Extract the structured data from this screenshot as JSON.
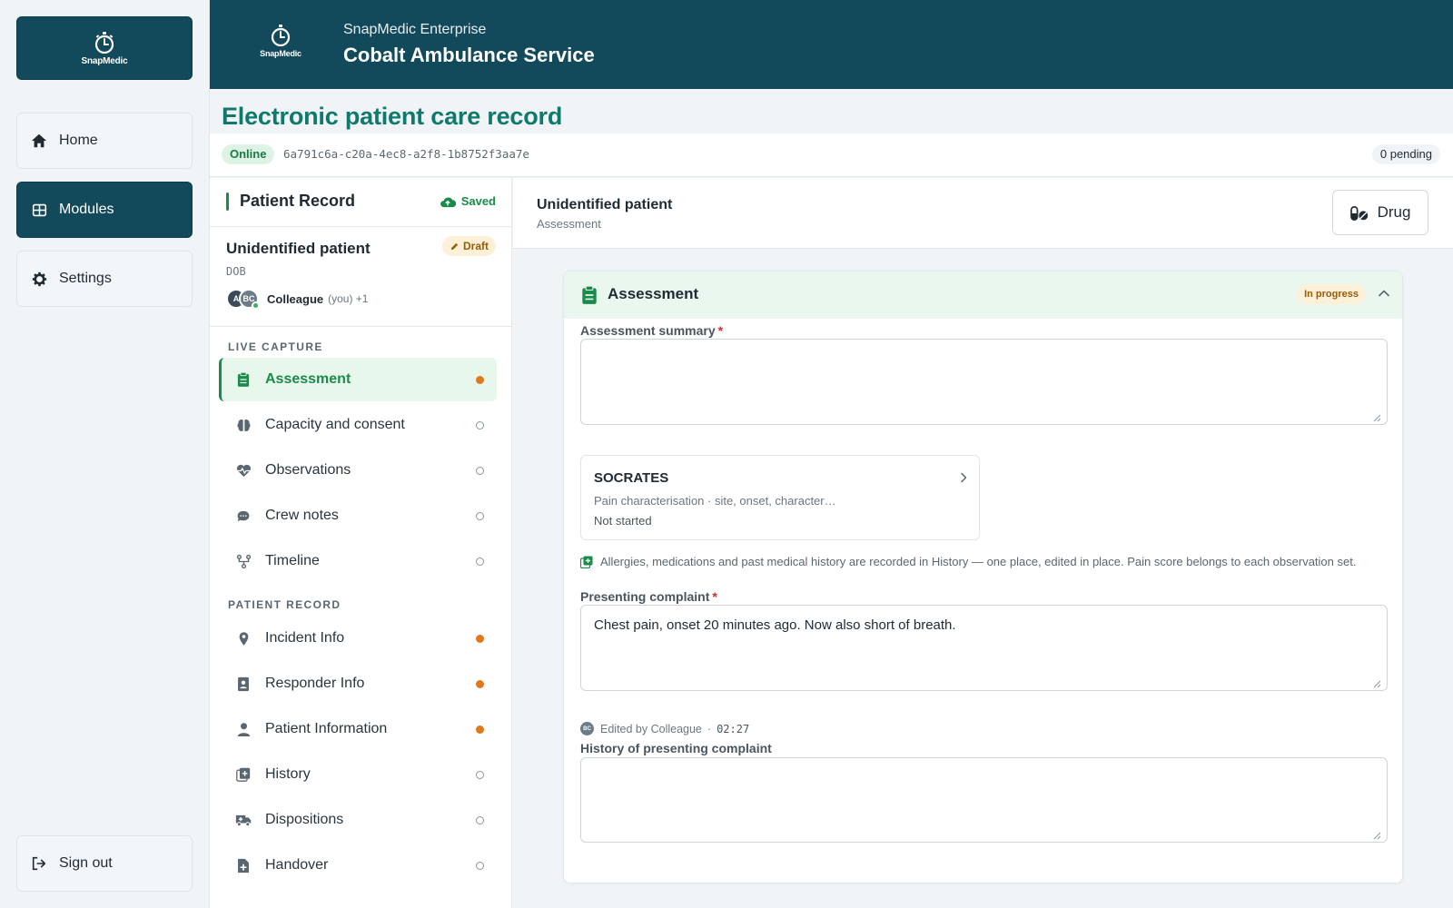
{
  "brand": {
    "logo_text": "SnapMedic"
  },
  "nav": {
    "home": "Home",
    "modules": "Modules",
    "settings": "Settings",
    "sign_out": "Sign out"
  },
  "header": {
    "org_sub": "SnapMedic Enterprise",
    "org_name": "Cobalt Ambulance Service"
  },
  "page": {
    "title": "Electronic patient care record",
    "online": "Online",
    "record_id": "6a791c6a-c20a-4ec8-a2f8-1b8752f3aa7e",
    "pending": "0 pending"
  },
  "patient_record": {
    "title": "Patient Record",
    "saved": "Saved",
    "patient_name": "Unidentified patient",
    "draft": "Draft",
    "dob": "DOB",
    "avatar_a": "A",
    "avatar_bc": "BC",
    "collaborator": "Colleague",
    "collaborator_meta": "(you) +1"
  },
  "sections": {
    "live_capture": "LIVE CAPTURE",
    "patient_record": "PATIENT RECORD"
  },
  "modules": [
    {
      "label": "Assessment",
      "icon": "clipboard-icon",
      "status": "filled"
    },
    {
      "label": "Capacity and consent",
      "icon": "brain-icon",
      "status": "empty"
    },
    {
      "label": "Observations",
      "icon": "heart-pulse-icon",
      "status": "empty"
    },
    {
      "label": "Crew notes",
      "icon": "comment-icon",
      "status": "empty"
    },
    {
      "label": "Timeline",
      "icon": "timeline-icon",
      "status": "empty"
    },
    {
      "label": "Incident Info",
      "icon": "location-pin-icon",
      "status": "filled"
    },
    {
      "label": "Responder Info",
      "icon": "id-badge-icon",
      "status": "filled"
    },
    {
      "label": "Patient Information",
      "icon": "person-icon",
      "status": "filled"
    },
    {
      "label": "History",
      "icon": "medical-history-icon",
      "status": "empty"
    },
    {
      "label": "Dispositions",
      "icon": "ambulance-icon",
      "status": "empty"
    },
    {
      "label": "Handover",
      "icon": "file-medical-icon",
      "status": "empty"
    }
  ],
  "right": {
    "patient": "Unidentified patient",
    "sub": "Assessment",
    "drug_button": "Drug"
  },
  "assessment": {
    "title": "Assessment",
    "status": "In progress",
    "summary_label": "Assessment summary",
    "summary_value": "",
    "socrates_title": "SOCRATES",
    "socrates_desc": "Pain characterisation · site, onset, character…",
    "socrates_status": "Not started",
    "note": "Allergies, medications and past medical history are recorded in History — one place, edited in place. Pain score belongs to each observation set.",
    "complaint_label": "Presenting complaint",
    "complaint_value": "Chest pain, onset 20 minutes ago. Now also short of breath.",
    "edited_avatar": "BC",
    "edited_by": "Edited by Colleague",
    "edited_sep": "·",
    "edited_time": "02:27",
    "hpc_label": "History of presenting complaint",
    "hpc_value": ""
  },
  "colors": {
    "brand": "#124a5c",
    "accent_green": "#1b8b4b",
    "title_teal": "#0f7a6c",
    "pending_orange": "#e0781c"
  }
}
